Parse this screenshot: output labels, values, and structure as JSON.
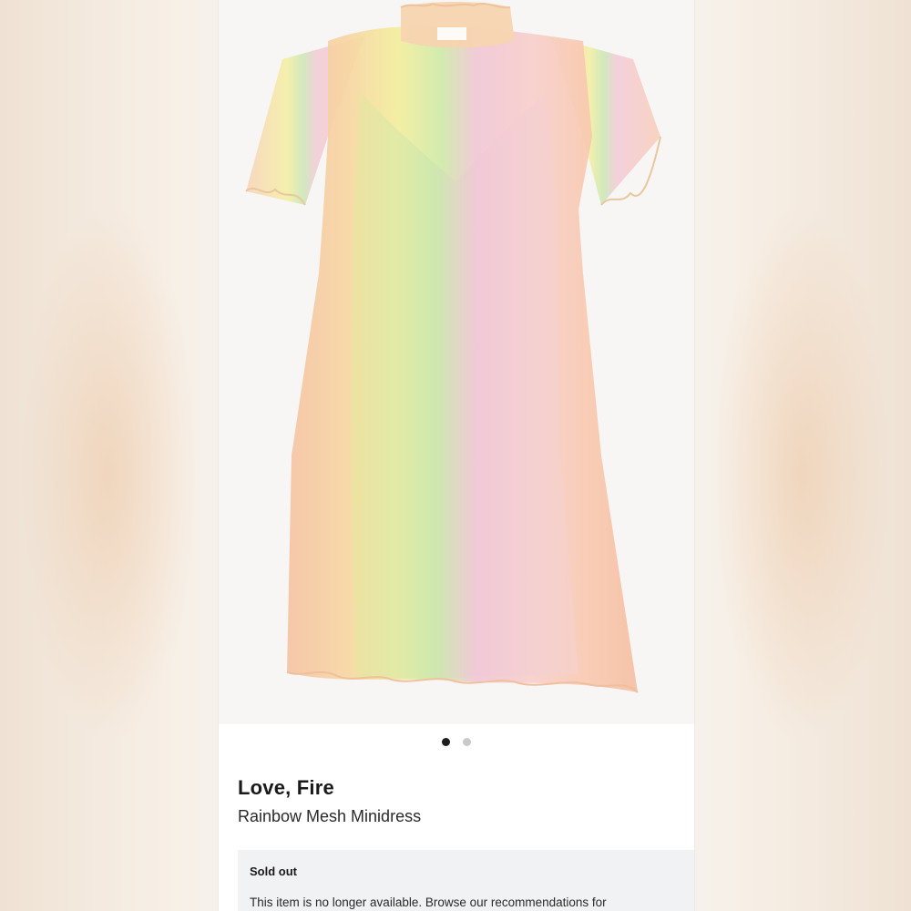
{
  "product": {
    "brand": "Love, Fire",
    "name": "Rainbow Mesh Minidress",
    "image_alt": "Rainbow ombré mesh short-sleeve minidress"
  },
  "carousel": {
    "total_images": 2,
    "active_index": 1
  },
  "availability": {
    "status": "Sold out",
    "message": "This item is no longer available. Browse our recommendations for"
  },
  "colors": {
    "accent": "#1d1d1d",
    "inactive_dot": "#c9c9c9",
    "notice_bg": "#f1f2f4"
  }
}
